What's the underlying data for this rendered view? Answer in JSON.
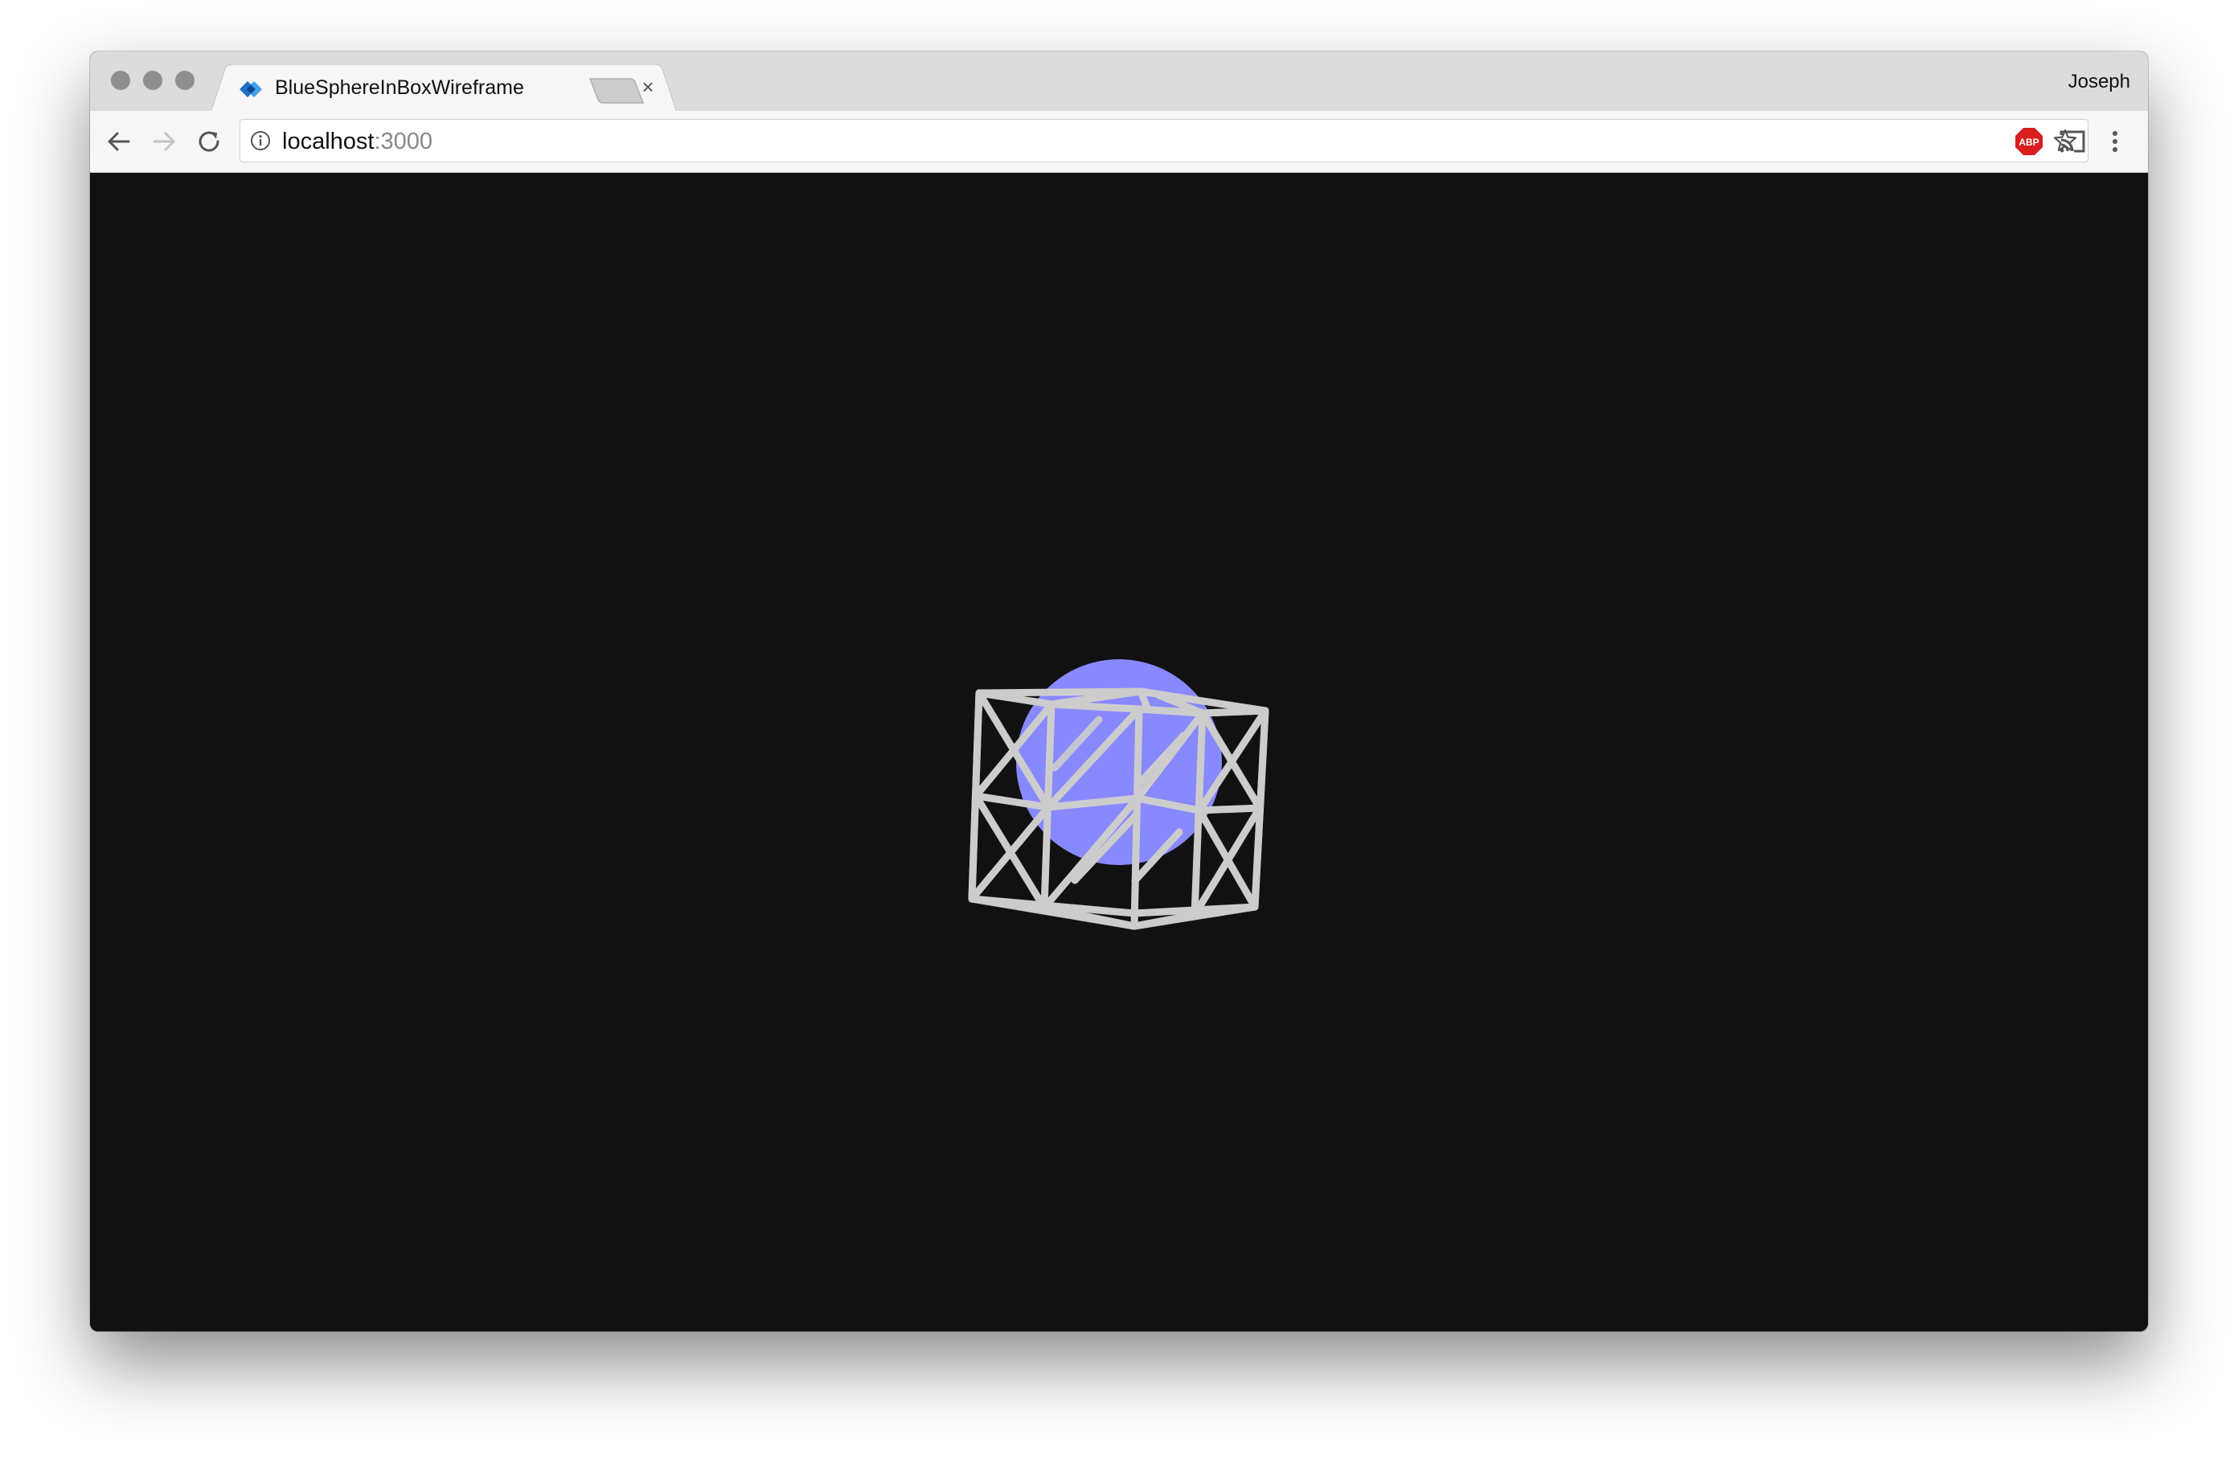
{
  "browser": {
    "window_controls": [
      "close",
      "minimize",
      "zoom"
    ],
    "tab": {
      "title": "BlueSphereInBoxWireframe",
      "favicon": "react-logo-icon",
      "close_label": "×"
    },
    "profile_name": "Joseph",
    "address_bar": {
      "host": "localhost",
      "port": ":3000"
    },
    "toolbar_icons": [
      "back-arrow-icon",
      "forward-arrow-icon",
      "reload-icon",
      "info-icon",
      "bookmark-star-icon",
      "adblock-icon",
      "cast-icon",
      "menu-icon"
    ],
    "adblock_label": "ABP"
  },
  "scene": {
    "background_color": "#111111",
    "sphere_color": "#8888ff",
    "wireframe_color": "#cccccc"
  }
}
